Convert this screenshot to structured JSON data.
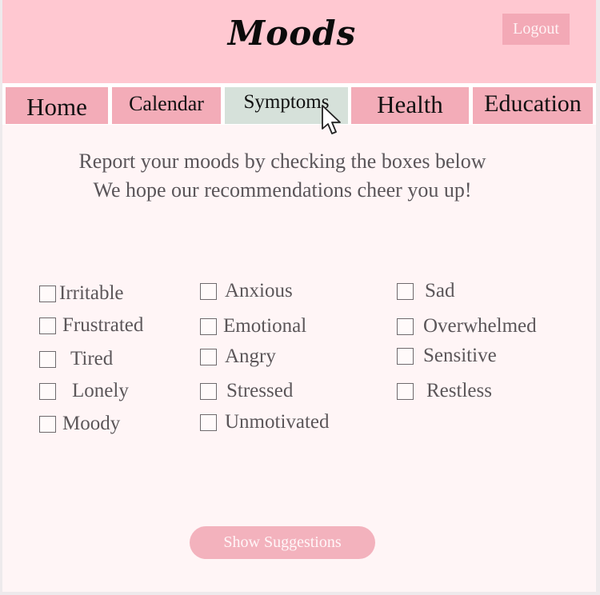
{
  "header": {
    "title": "Moods",
    "logout_label": "Logout"
  },
  "nav": {
    "tabs": [
      {
        "label": "Home"
      },
      {
        "label": "Calendar"
      },
      {
        "label": "Symptoms",
        "active": true
      },
      {
        "label": "Health"
      },
      {
        "label": "Education"
      }
    ]
  },
  "intro": {
    "line1": "Report your moods by checking the boxes below",
    "line2": "We hope our recommendations cheer you up!"
  },
  "moods": {
    "column1": [
      "Irritable",
      "Frustrated",
      "Tired",
      "Lonely",
      "Moody"
    ],
    "column2": [
      "Anxious",
      "Emotional",
      "Angry",
      "Stressed",
      "Unmotivated"
    ],
    "column3": [
      "Sad",
      "Overwhelmed",
      "Sensitive",
      "Restless"
    ]
  },
  "actions": {
    "show_suggestions_label": "Show Suggestions"
  },
  "colors": {
    "header_bg": "#ffc8d1",
    "tab_bg": "#f3acb8",
    "tab_active_bg": "#d6e1da",
    "page_bg": "#fff5f6",
    "button_bg": "#f3b2bd"
  }
}
